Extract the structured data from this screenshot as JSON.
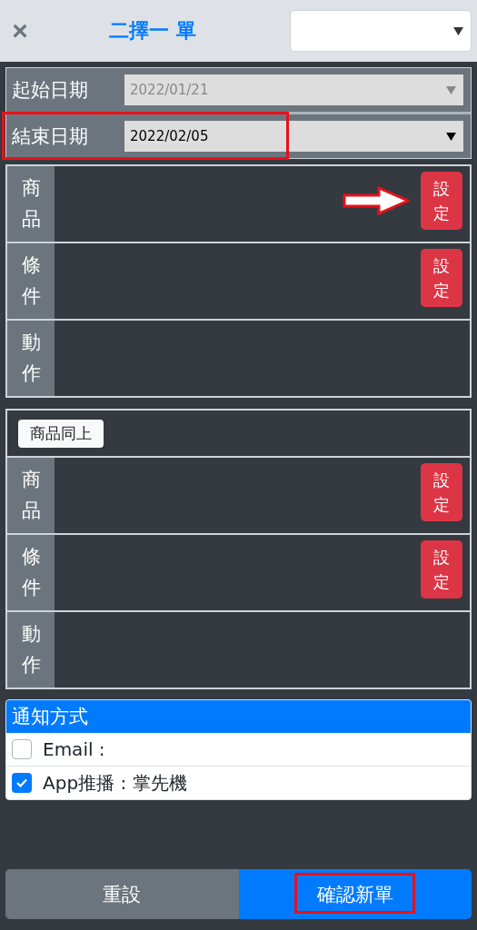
{
  "header": {
    "close": "×",
    "title": "二擇一 單"
  },
  "dates": [
    {
      "label": "起始日期",
      "value": "2022/01/21",
      "disabled": true,
      "highlighted": false
    },
    {
      "label": "結束日期",
      "value": "2022/02/05",
      "disabled": false,
      "highlighted": true
    }
  ],
  "sections": [
    {
      "rows": [
        {
          "label": "商品",
          "button": "設定",
          "arrow": true
        },
        {
          "label": "條件",
          "button": "設定",
          "arrow": false
        },
        {
          "label": "動作",
          "arrow": false
        }
      ]
    },
    {
      "copy_button": "商品同上",
      "rows": [
        {
          "label": "商品",
          "button": "設定",
          "arrow": false
        },
        {
          "label": "條件",
          "button": "設定",
          "arrow": false
        },
        {
          "label": "動作",
          "arrow": false
        }
      ]
    }
  ],
  "notification": {
    "title": "通知方式",
    "options": [
      {
        "label": "Email :",
        "checked": false
      },
      {
        "label": "App推播 : 掌先機",
        "checked": true
      }
    ]
  },
  "footer": [
    {
      "label": "重設",
      "kind": "secondary",
      "highlighted": false
    },
    {
      "label": "確認新單",
      "kind": "primary",
      "highlighted": true
    }
  ]
}
